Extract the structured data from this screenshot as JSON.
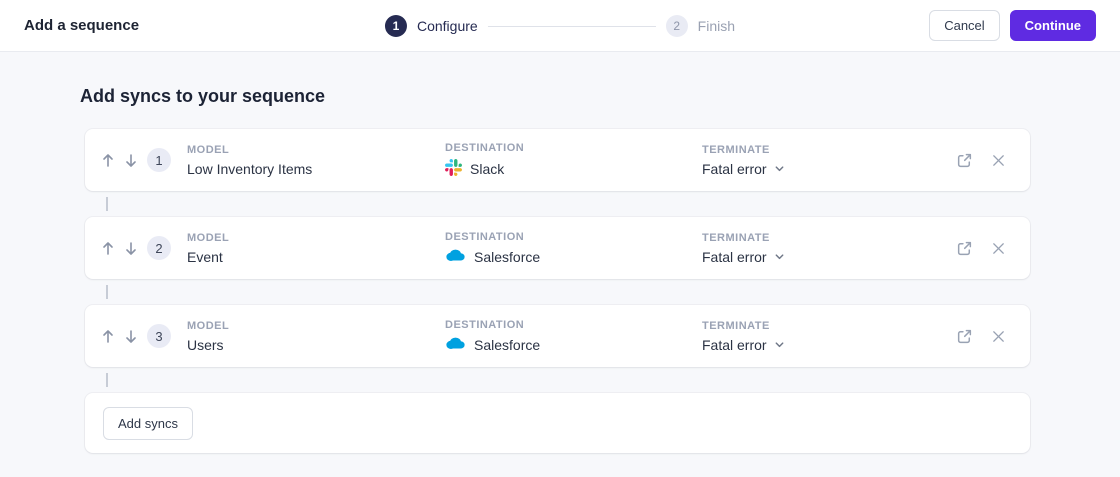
{
  "header": {
    "title": "Add a sequence",
    "stepper": {
      "steps": [
        {
          "number": "1",
          "label": "Configure",
          "state": "active"
        },
        {
          "number": "2",
          "label": "Finish",
          "state": "inactive"
        }
      ]
    },
    "cancel_label": "Cancel",
    "continue_label": "Continue"
  },
  "main": {
    "heading": "Add syncs to your sequence",
    "columns": {
      "model": "MODEL",
      "destination": "DESTINATION",
      "terminate": "TERMINATE"
    },
    "rows": [
      {
        "index": "1",
        "model": "Low Inventory Items",
        "destination": "Slack",
        "destination_icon": "slack-icon",
        "terminate": "Fatal error"
      },
      {
        "index": "2",
        "model": "Event",
        "destination": "Salesforce",
        "destination_icon": "salesforce-icon",
        "terminate": "Fatal error"
      },
      {
        "index": "3",
        "model": "Users",
        "destination": "Salesforce",
        "destination_icon": "salesforce-icon",
        "terminate": "Fatal error"
      }
    ],
    "add_syncs_label": "Add syncs"
  },
  "icons": [
    "arrow-up-icon",
    "arrow-down-icon",
    "slack-icon",
    "salesforce-icon",
    "chevron-down-icon",
    "external-link-icon",
    "close-icon"
  ],
  "colors": {
    "accent": "#5f2be2",
    "step_active_bg": "#262b52",
    "step_inactive_bg": "#e9ebf4",
    "page_bg": "#f7f8fb",
    "card_bg": "#ffffff",
    "label_gray": "#9aa2b4",
    "text_dark": "#2b3344",
    "slack_blue": "#36c5f0",
    "slack_green": "#2eb67d",
    "slack_yellow": "#ecb22e",
    "slack_red": "#e01e5a",
    "salesforce_blue": "#00a1e0"
  }
}
